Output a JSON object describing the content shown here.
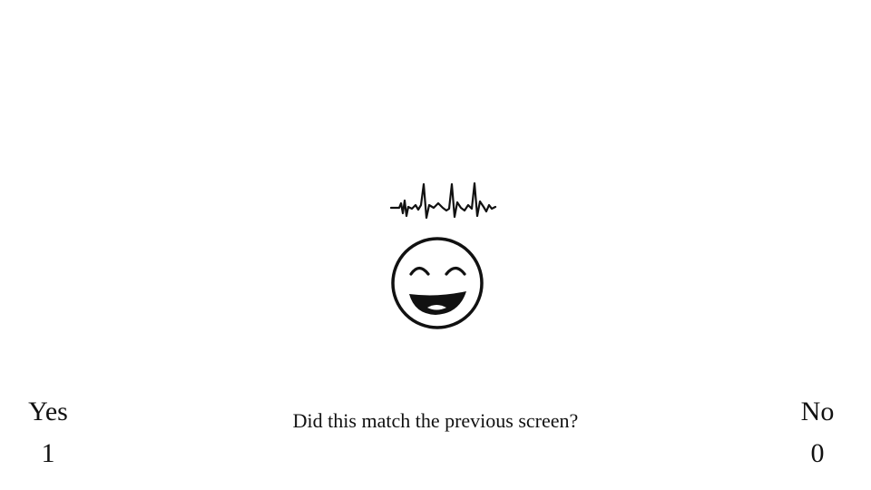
{
  "stimulus": {
    "icon": "laughing-face-with-sound-wave-icon"
  },
  "prompt": {
    "text": "Did this match the previous screen?"
  },
  "responses": {
    "yes": {
      "label": "Yes",
      "key": "1"
    },
    "no": {
      "label": "No",
      "key": "0"
    }
  },
  "colors": {
    "background": "#ffffff",
    "ink": "#111111"
  }
}
